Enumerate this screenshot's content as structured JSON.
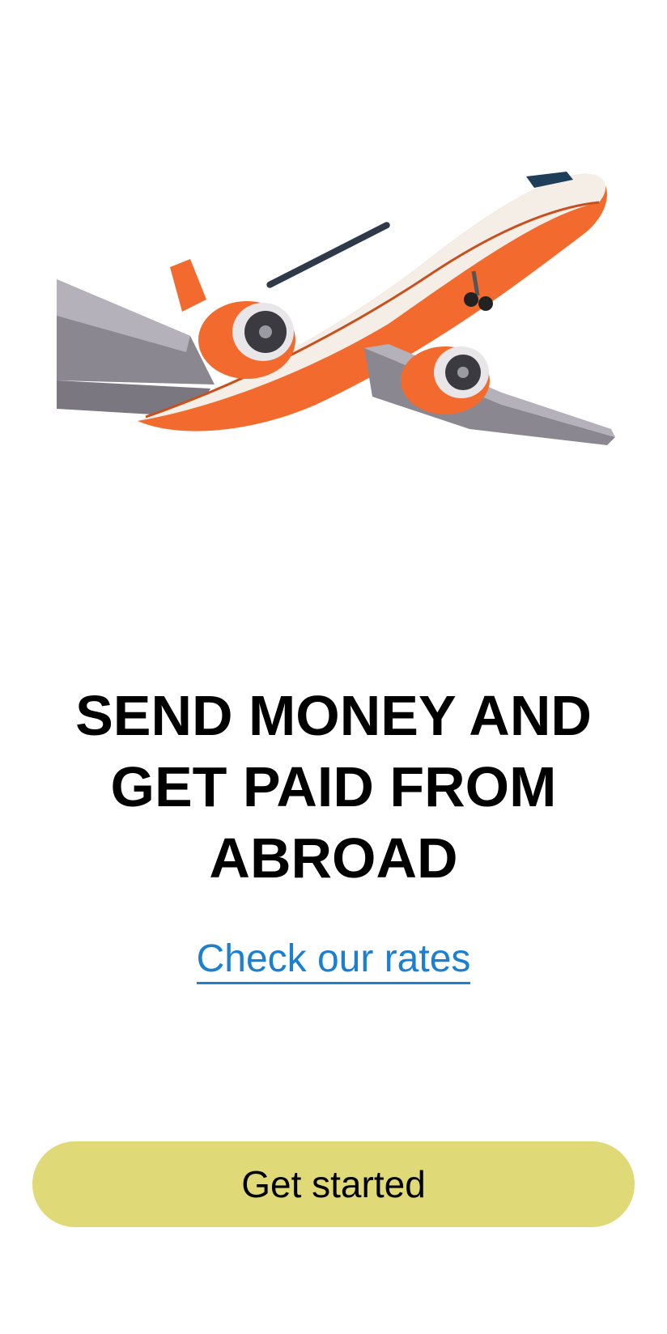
{
  "hero": {
    "illustration": "airplane-illustration",
    "fuselage_color": "#f26a2e",
    "body_color": "#f4eee7"
  },
  "headline": {
    "text": "SEND MONEY AND GET PAID FROM ABROAD"
  },
  "rates_link": {
    "label": "Check our rates",
    "color": "#1d7fd0"
  },
  "cta": {
    "label": "Get started",
    "color": "#dfd977"
  }
}
